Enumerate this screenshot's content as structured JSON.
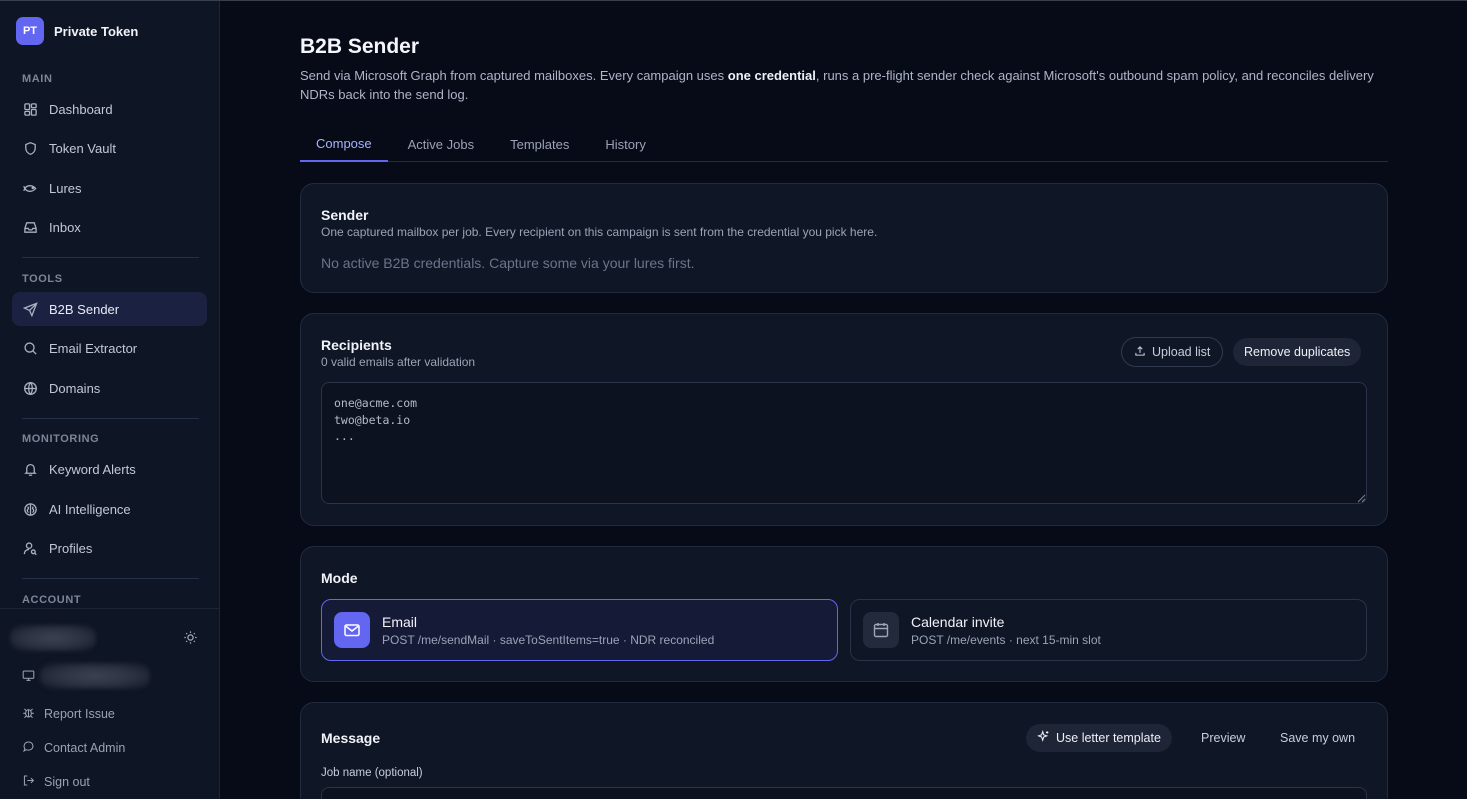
{
  "brand": {
    "initials": "PT",
    "name": "Private Token"
  },
  "sidebar": {
    "sections": {
      "main": "MAIN",
      "tools": "TOOLS",
      "monitoring": "MONITORING",
      "account": "ACCOUNT"
    },
    "items": [
      {
        "label": "Dashboard",
        "icon": "dashboard-icon"
      },
      {
        "label": "Token Vault",
        "icon": "shield-icon"
      },
      {
        "label": "Lures",
        "icon": "fish-icon"
      },
      {
        "label": "Inbox",
        "icon": "inbox-icon"
      },
      {
        "label": "B2B Sender",
        "icon": "send-icon",
        "active": true
      },
      {
        "label": "Email Extractor",
        "icon": "search-icon"
      },
      {
        "label": "Domains",
        "icon": "globe-icon"
      },
      {
        "label": "Keyword Alerts",
        "icon": "bell-icon"
      },
      {
        "label": "AI Intelligence",
        "icon": "brain-icon"
      },
      {
        "label": "Profiles",
        "icon": "user-search-icon"
      }
    ],
    "footer": {
      "report": "Report Issue",
      "contact": "Contact Admin",
      "signout": "Sign out"
    }
  },
  "page": {
    "title": "B2B Sender",
    "desc_before": "Send via Microsoft Graph from captured mailboxes. Every campaign uses ",
    "desc_bold": "one credential",
    "desc_after": ", runs a pre-flight sender check against Microsoft's outbound spam policy, and reconciles delivery NDRs back into the send log."
  },
  "tabs": [
    "Compose",
    "Active Jobs",
    "Templates",
    "History"
  ],
  "sender": {
    "title": "Sender",
    "subtitle": "One captured mailbox per job. Every recipient on this campaign is sent from the credential you pick here.",
    "empty": "No active B2B credentials. Capture some via your lures first."
  },
  "recipients": {
    "title": "Recipients",
    "subtitle": "0 valid emails after validation",
    "upload_label": "Upload list",
    "dedupe_label": "Remove duplicates",
    "placeholder": "one@acme.com\ntwo@beta.io\n..."
  },
  "mode": {
    "title": "Mode",
    "options": [
      {
        "name": "Email",
        "desc": "POST /me/sendMail · saveToSentItems=true · NDR reconciled",
        "selected": true
      },
      {
        "name": "Calendar invite",
        "desc": "POST /me/events · next 15-min slot",
        "selected": false
      }
    ]
  },
  "message": {
    "title": "Message",
    "template_label": "Use letter template",
    "preview_label": "Preview",
    "save_label": "Save my own",
    "job_name_label": "Job name (optional)"
  },
  "colors": {
    "accent": "#6366f1",
    "background": "#070b18",
    "card": "#0f1626"
  }
}
